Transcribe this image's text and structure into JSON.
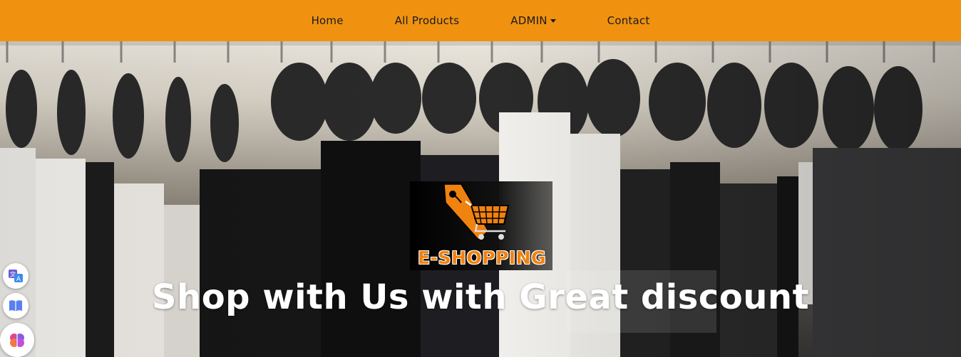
{
  "navbar": {
    "items": [
      {
        "label": "Home"
      },
      {
        "label": "All Products"
      },
      {
        "label": "ADMIN",
        "dropdown": true
      },
      {
        "label": "Contact"
      }
    ],
    "background": "#f0920f"
  },
  "hero": {
    "logo_text": "E-SHOPPING",
    "headline": "Shop with Us with Great discount"
  },
  "side_tools": [
    {
      "icon": "translate-icon"
    },
    {
      "icon": "reader-icon"
    },
    {
      "icon": "brain-icon"
    }
  ],
  "colors": {
    "accent": "#f0920f",
    "logo": "#f0820f"
  }
}
